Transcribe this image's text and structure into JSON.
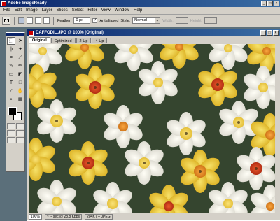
{
  "app": {
    "title": "Adobe ImageReady"
  },
  "window_buttons": [
    "_",
    "□",
    "×"
  ],
  "menu": [
    "File",
    "Edit",
    "Image",
    "Layer",
    "Slices",
    "Select",
    "Filter",
    "View",
    "Window",
    "Help"
  ],
  "options": {
    "feather_label": "Feather:",
    "feather_value": "0 px",
    "antialiased_label": "Antialiased",
    "antialiased_checked": "✓",
    "style_label": "Style:",
    "style_value": "Normal",
    "width_label": "Width:",
    "height_label": "Height:"
  },
  "document": {
    "title": "DAFFODIL.JPG @ 100% (Original)",
    "tabs": [
      "Original",
      "Optimized",
      "2-Up",
      "4-Up"
    ],
    "status": {
      "zoom": "100%",
      "timing": "~ -- sec @ 28.8 Kbps",
      "size": "204K / -- JPEG"
    }
  },
  "colors": {
    "petal_white": "#f4f1e6",
    "petal_yellow": "#efcf3a",
    "cup_orange": "#e88a1e",
    "cup_red": "#d23a1c",
    "leaf_dark": "#2c3a2c"
  }
}
